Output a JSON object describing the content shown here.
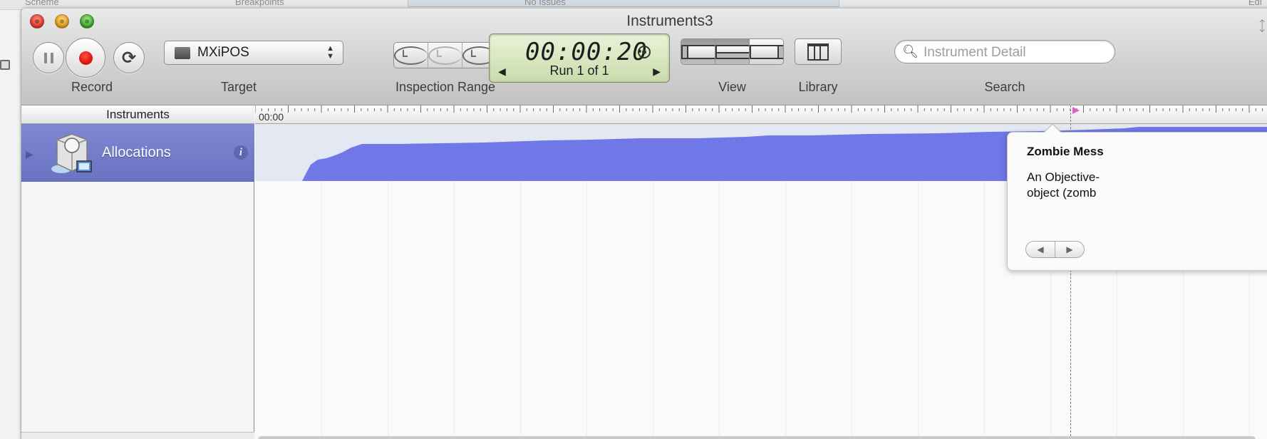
{
  "background": {
    "scheme_label": "Scheme",
    "breakpoints_label": "Breakpoints",
    "issues_label": "No Issues",
    "edit_label": "Edi"
  },
  "window": {
    "title": "Instruments3"
  },
  "toolbar": {
    "record_label": "Record",
    "target_label": "Target",
    "target_value": "MXiPOS",
    "inspection_label": "Inspection Range",
    "timer": "00:00:20",
    "run_text": "Run 1 of 1",
    "view_label": "View",
    "library_label": "Library",
    "search_label": "Search",
    "search_placeholder": "Instrument Detail"
  },
  "instruments_pane": {
    "header": "Instruments",
    "tracks": [
      {
        "label": "Allocations",
        "icon": "allocations-instrument-icon"
      }
    ]
  },
  "timeline": {
    "start_label": "00:00"
  },
  "popover": {
    "title": "Zombie Mess",
    "body_line1": "An Objective-",
    "body_line2": "object (zomb"
  },
  "colors": {
    "track_fill": "#7077e6",
    "track_selected": "#6f79c8",
    "record_red": "#e01a0e"
  }
}
